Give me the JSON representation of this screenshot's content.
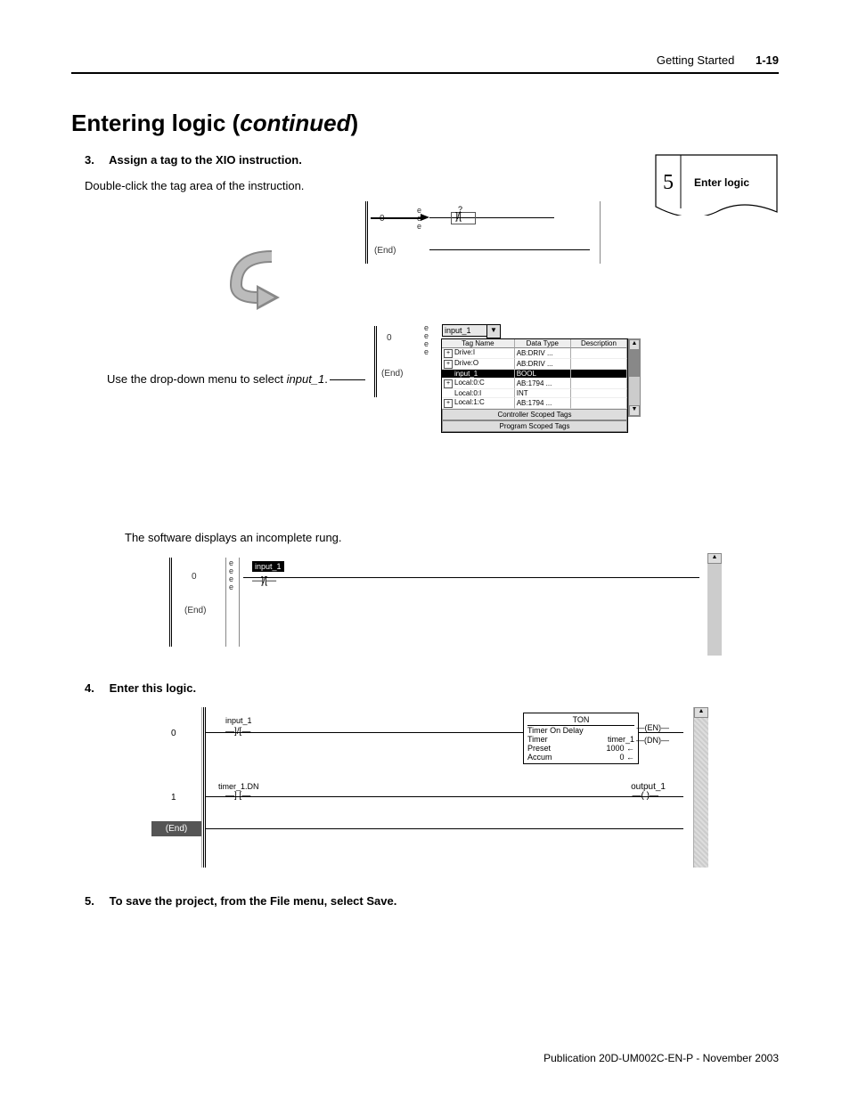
{
  "header": {
    "section": "Getting Started",
    "page": "1-19"
  },
  "title": {
    "main": "Entering logic (",
    "continued": "continued",
    "suffix": ")"
  },
  "flag": {
    "num": "5",
    "label": "Enter logic"
  },
  "step3": {
    "num": "3.",
    "title": "Assign a tag to the XIO instruction.",
    "text": "Double-click the tag area of the instruction."
  },
  "fig1": {
    "rung0": "0",
    "end": "(End)",
    "q": "?",
    "e": "e"
  },
  "fig2": {
    "caption_before": "Use the drop-down menu to select ",
    "caption_tag": "input_1",
    "caption_after": ".",
    "input": "input_1",
    "headers": [
      "Tag Name",
      "Data Type",
      "Description"
    ],
    "rows": [
      {
        "name": "Drive:I",
        "type": "AB:DRIV ..."
      },
      {
        "name": "Drive:O",
        "type": "AB:DRIV ..."
      },
      {
        "name": "input_1",
        "type": "BOOL",
        "sel": true
      },
      {
        "name": "Local:0:C",
        "type": "AB:1794 ..."
      },
      {
        "name": "Local:0:I",
        "type": "INT"
      },
      {
        "name": "Local:1:C",
        "type": "AB:1794 ..."
      }
    ],
    "btn1": "Controller Scoped Tags",
    "btn2": "Program Scoped Tags",
    "rung0": "0",
    "end": "(End)",
    "e": "e"
  },
  "midtext": "The software displays an incomplete rung.",
  "fig3": {
    "rung0": "0",
    "end": "(End)",
    "input": "input_1",
    "e": "e"
  },
  "step4": {
    "num": "4.",
    "title": "Enter this logic."
  },
  "fig4": {
    "rung0": "0",
    "rung1": "1",
    "end": "(End)",
    "xio": "input_1",
    "ton_title": "TON",
    "ton_name": "Timer On Delay",
    "ton_timer_lbl": "Timer",
    "ton_timer_val": "timer_1",
    "ton_preset_lbl": "Preset",
    "ton_preset_val": "1000 ←",
    "ton_accum_lbl": "Accum",
    "ton_accum_val": "0 ←",
    "en": "EN",
    "dn": "DN",
    "xic": "timer_1.DN",
    "coil": "output_1"
  },
  "step5": {
    "num": "5.",
    "title": "To save the project, from the File menu, select Save."
  },
  "footer": "Publication 20D-UM002C-EN-P - November 2003"
}
